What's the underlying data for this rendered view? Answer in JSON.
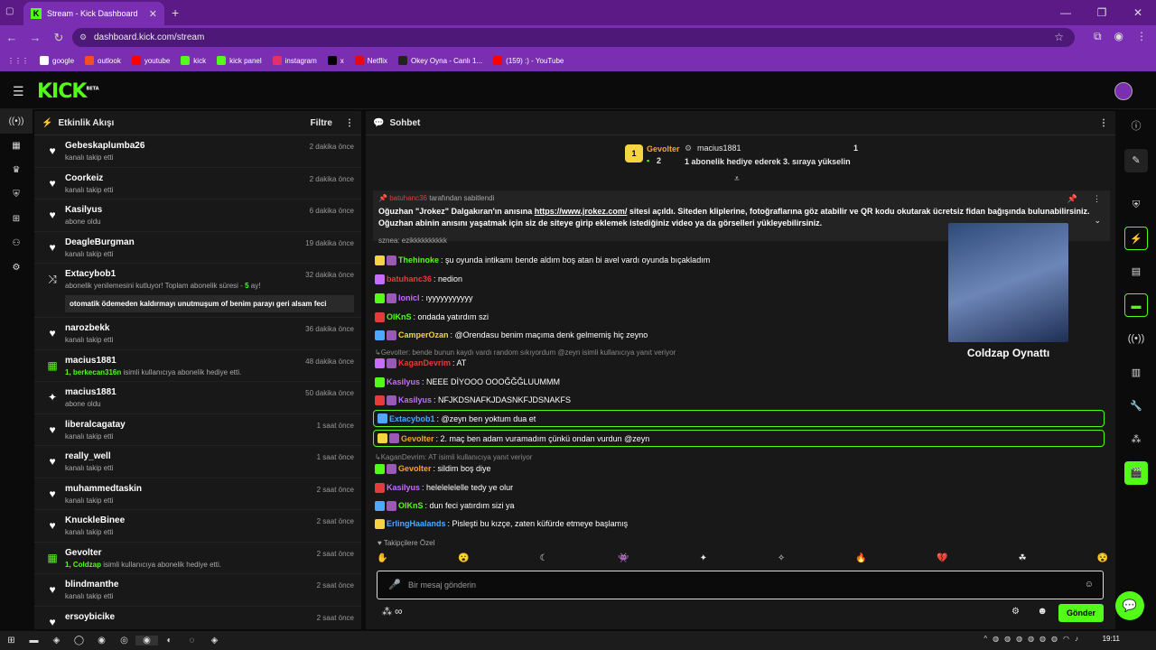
{
  "browser": {
    "tab_title": "Stream - Kick Dashboard",
    "url": "dashboard.kick.com/stream",
    "bookmarks": [
      {
        "label": "google",
        "color": "#ffffff"
      },
      {
        "label": "outlook",
        "color": "#f25022"
      },
      {
        "label": "youtube",
        "color": "#ff0000"
      },
      {
        "label": "kick",
        "color": "#53fc18"
      },
      {
        "label": "kick panel",
        "color": "#53fc18"
      },
      {
        "label": "instagram",
        "color": "#e1306c"
      },
      {
        "label": "x",
        "color": "#000000"
      },
      {
        "label": "Netflix",
        "color": "#e50914"
      },
      {
        "label": "Okey Oyna - Canlı 1...",
        "color": "#222222"
      },
      {
        "label": "(159) :) - YouTube",
        "color": "#ff0000"
      }
    ]
  },
  "app": {
    "logo": "KICK",
    "logo_tag": "BETA"
  },
  "feed": {
    "title": "Etkinlik Akışı",
    "filter": "Filtre",
    "events": [
      {
        "icon": "heart",
        "name": "Gebeskaplumba26",
        "sub": "kanalı takip etti",
        "time": "2 dakika önce"
      },
      {
        "icon": "heart",
        "name": "Coorkeiz",
        "sub": "kanalı takip etti",
        "time": "2 dakika önce"
      },
      {
        "icon": "heart",
        "name": "Kasilyus",
        "sub": "abone oldu",
        "time": "6 dakika önce"
      },
      {
        "icon": "heart",
        "name": "DeagleBurgman",
        "sub": "kanalı takip etti",
        "time": "19 dakika önce"
      },
      {
        "icon": "renew",
        "name": "Extacybob1",
        "sub": "abonelik yenilemesini kutluyor! Toplam abonelik süresi - ",
        "sub_num": "5",
        "sub_end": " ay!",
        "message": "otomatik ödemeden kaldırmayı unutmuşum of benim parayı geri alsam feci",
        "time": "32 dakika önce"
      },
      {
        "icon": "heart",
        "name": "narozbekk",
        "sub": "kanalı takip etti",
        "time": "36 dakika önce"
      },
      {
        "icon": "gift",
        "name": "macius1881",
        "sub_gift": "1, berkecan316n",
        "sub": " isimli kullanıcıya abonelik hediye etti.",
        "time": "48 dakika önce"
      },
      {
        "icon": "sparkle",
        "name": "macius1881",
        "sub": "abone oldu",
        "time": "50 dakika önce"
      },
      {
        "icon": "heart",
        "name": "liberalcagatay",
        "sub": "kanalı takip etti",
        "time": "1 saat önce"
      },
      {
        "icon": "heart",
        "name": "really_well",
        "sub": "kanalı takip etti",
        "time": "1 saat önce"
      },
      {
        "icon": "heart",
        "name": "muhammedtaskin",
        "sub": "kanalı takip etti",
        "time": "2 saat önce"
      },
      {
        "icon": "heart",
        "name": "KnuckleBinee",
        "sub": "kanalı takip etti",
        "time": "2 saat önce"
      },
      {
        "icon": "gift",
        "name": "Gevolter",
        "sub_gift": "1, Coldzap",
        "sub": " isimli kullanıcıya abonelik hediye etti.",
        "time": "2 saat önce"
      },
      {
        "icon": "heart",
        "name": "blindmanthe",
        "sub": "kanalı takip etti",
        "time": "2 saat önce"
      },
      {
        "icon": "heart",
        "name": "ersoybicike",
        "sub": "",
        "time": "2 saat önce"
      }
    ]
  },
  "chat": {
    "title": "Sohbet",
    "gifter1": {
      "rank": "1",
      "name": "Gevolter",
      "count": "2"
    },
    "gifter2": {
      "name": "macius1881",
      "count": "1",
      "text": "1 abonelik hediye ederek 3. sıraya yükselin"
    },
    "pinned": {
      "by": "batuhanc36",
      "by_suffix": "tarafından sabitlendi",
      "text_a": "Oğuzhan \"Jrokez\" Dalgakıran'ın anısına ",
      "link": "https://www.jrokez.com/",
      "text_b": " sitesi açıldı. Siteden kliplerine, fotoğraflarına göz atabilir ve QR kodu okutarak ücretsiz fidan bağışında bulunabilirsiniz. Oğuzhan abinin anısını yaşatmak için siz de siteye girip eklemek istediğiniz video ya da görselleri yükleyebilirsiniz."
    },
    "partial_line": "sznea: ezikkkkkkkkkk",
    "messages": [
      {
        "user": "Thehinoke",
        "color": "#53fc18",
        "text": ": şu oyunda intikamı bende aldım boş atan bi avel vardı oyunda bıçakladım"
      },
      {
        "user": "batuhanc36",
        "color": "#e53b3b",
        "text": ": nedion"
      },
      {
        "user": "lonicl",
        "color": "#c66cff",
        "text": ": ıyyyyyyyyyyy"
      },
      {
        "user": "OlKnS",
        "color": "#53fc18",
        "text": ": ondada yatırdım szi"
      },
      {
        "user": "CamperOzan",
        "color": "#f5d442",
        "text": ": @Orendasu benim maçıma denk gelmemiş hiç zeyno"
      },
      {
        "reply": "Gevolter: bende bunun kaydı vardı random sıkıyordum @zeyn isimli kullanıcıya yanıt veriyor"
      },
      {
        "user": "KaganDevrim",
        "color": "#e53b3b",
        "text": ": AT"
      },
      {
        "user": "Kasilyus",
        "color": "#c66cff",
        "text": ": NEEE DİYOOO OOOĞĞĞLUUMMM"
      },
      {
        "user": "Kasilyus",
        "color": "#c66cff",
        "text": ": NFJKDSNAFKJDASNKFJDSNAKFS"
      },
      {
        "user": "Extacybob1",
        "color": "#4fa8ff",
        "text": ": @zeyn ben yoktum dua et",
        "highlight": true
      },
      {
        "user": "Gevolter",
        "color": "#f5a623",
        "text": ": 2. maç ben adam vuramadım çünkü ondan vurdun @zeyn",
        "highlight": true
      },
      {
        "reply": "KaganDevrim: AT isimli kullanıcıya yanıt veriyor"
      },
      {
        "user": "Gevolter",
        "color": "#f5a623",
        "text": ": sildim boş diye"
      },
      {
        "user": "Kasilyus",
        "color": "#c66cff",
        "text": ": helelelelelle tedy ye olur"
      },
      {
        "user": "OlKnS",
        "color": "#53fc18",
        "text": ": dun feci yatırdım sizi ya"
      },
      {
        "user": "ErlingHaalands",
        "color": "#4fa8ff",
        "text": ": Pisleşti bu kızçe, zaten küfürde etmeye başlamış"
      }
    ],
    "overlay_label": "Coldzap Oynattı",
    "follower_only": "Takipçilere Özel",
    "input_placeholder": "Bir mesaj gönderin",
    "send_label": "Gönder",
    "infinity": "∞"
  },
  "taskbar": {
    "time": "19:11"
  }
}
